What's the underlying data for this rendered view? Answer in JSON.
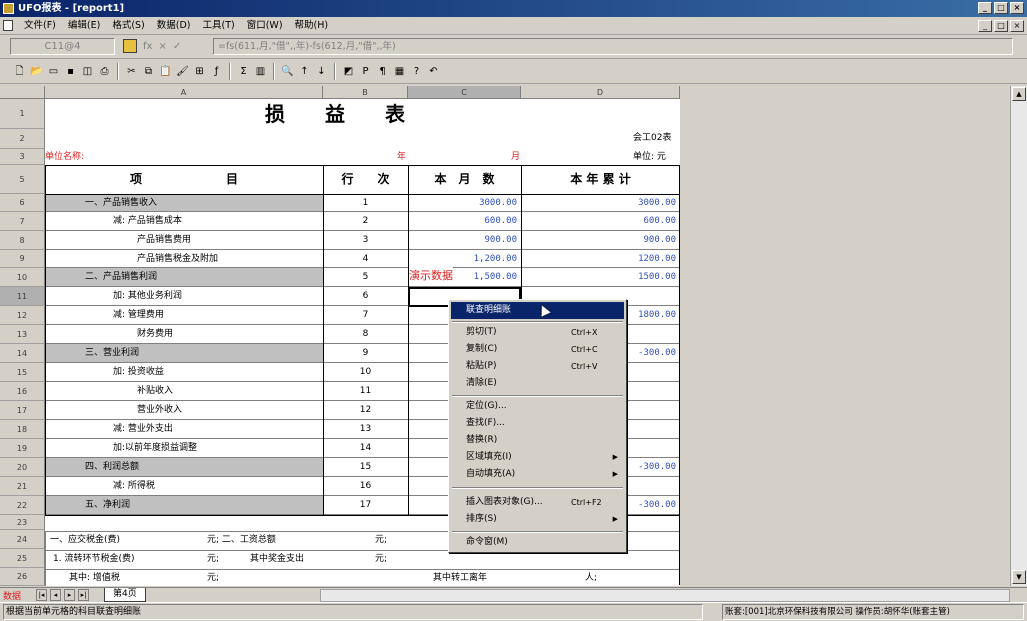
{
  "window": {
    "title": "UFO报表 - [report1]",
    "min": "_",
    "max": "□",
    "close": "×"
  },
  "menubar": {
    "items": [
      "文件(F)",
      "编辑(E)",
      "格式(S)",
      "数据(D)",
      "工具(T)",
      "窗口(W)",
      "帮助(H)"
    ]
  },
  "formulabar": {
    "cellref": "C11@4",
    "fx": "fx",
    "cancel": "×",
    "accept": "✓",
    "formula": "=fs(611,月,\"借\",,年)-fs(612,月,\"借\",,年)"
  },
  "toolbar": {
    "icons": [
      "new-icon",
      "open-icon",
      "close-file-icon",
      "save-icon",
      "print-preview-icon",
      "print-icon",
      "cut-icon",
      "copy-icon",
      "paste-icon",
      "format-painter-icon",
      "insert-icon",
      "function-icon",
      "sum-icon",
      "chart-icon",
      "find-icon",
      "sort-asc-icon",
      "sort-desc-icon",
      "style-icon",
      "bold-icon",
      "mode-icon",
      "page-icon",
      "help-icon",
      "undo-icon"
    ]
  },
  "columns": [
    "A",
    "B",
    "C",
    "D"
  ],
  "rows": [
    "1",
    "2",
    "3",
    "5",
    "6",
    "7",
    "8",
    "9",
    "10",
    "11",
    "12",
    "13",
    "14",
    "15",
    "16",
    "17",
    "18",
    "19",
    "20",
    "21",
    "22",
    "23",
    "24",
    "25",
    "26"
  ],
  "report": {
    "title": "损　　益　　表",
    "form_no": "会工02表",
    "unit_name_label": "单位名称:",
    "year_label": "年",
    "month_label": "月",
    "currency_label": "单位: 元",
    "headers": {
      "item": "项　　　　　　　目",
      "line": "行　　次",
      "month": "本　月　数",
      "year": "本 年 累 计"
    },
    "lines": [
      {
        "item": "一、产品销售收入",
        "line": "1",
        "month": "3000.00",
        "year": "3000.00",
        "grey": true,
        "indent": 1
      },
      {
        "item": "减: 产品销售成本",
        "line": "2",
        "month": "600.00",
        "year": "600.00",
        "grey": false,
        "indent": 2
      },
      {
        "item": "产品销售费用",
        "line": "3",
        "month": "900.00",
        "year": "900.00",
        "grey": false,
        "indent": 3
      },
      {
        "item": "产品销售税金及附加",
        "line": "4",
        "month": "1,200.00",
        "year": "1200.00",
        "grey": false,
        "indent": 3
      },
      {
        "item": "二、产品销售利润",
        "line": "5",
        "month": "1,500.00",
        "year": "1500.00",
        "grey": true,
        "indent": 1
      },
      {
        "item": "加: 其他业务利润",
        "line": "6",
        "month": "",
        "year": "",
        "grey": false,
        "indent": 2
      },
      {
        "item": "减: 管理费用",
        "line": "7",
        "month": "",
        "year": "1800.00",
        "grey": false,
        "indent": 2
      },
      {
        "item": "财务费用",
        "line": "8",
        "month": "",
        "year": "",
        "grey": false,
        "indent": 3
      },
      {
        "item": "三、营业利润",
        "line": "9",
        "month": "",
        "year": "-300.00",
        "grey": true,
        "indent": 1
      },
      {
        "item": "加: 投资收益",
        "line": "10",
        "month": "",
        "year": "",
        "grey": false,
        "indent": 2
      },
      {
        "item": "补贴收入",
        "line": "11",
        "month": "",
        "year": "",
        "grey": false,
        "indent": 3
      },
      {
        "item": "营业外收入",
        "line": "12",
        "month": "",
        "year": "",
        "grey": false,
        "indent": 3
      },
      {
        "item": "减: 营业外支出",
        "line": "13",
        "month": "",
        "year": "",
        "grey": false,
        "indent": 2
      },
      {
        "item": "加:以前年度损益调整",
        "line": "14",
        "month": "",
        "year": "",
        "grey": false,
        "indent": 2
      },
      {
        "item": "四、利润总额",
        "line": "15",
        "month": "",
        "year": "-300.00",
        "grey": true,
        "indent": 1
      },
      {
        "item": "减: 所得税",
        "line": "16",
        "month": "",
        "year": "",
        "grey": false,
        "indent": 2
      },
      {
        "item": "五、净利润",
        "line": "17",
        "month": "",
        "year": "-300.00",
        "grey": true,
        "indent": 1
      }
    ],
    "notes": {
      "r24a": "一、应交税金(费)",
      "r24b": "元; 二、工资总额",
      "r24c": "元;",
      "r25a": "1. 流转环节税金(费)",
      "r25b": "元;",
      "r25c": "其中奖金支出",
      "r25d": "元;",
      "r26a": "其中: 增值税",
      "r26b": "元;",
      "r26c": "其中转工离年",
      "r26d": "人;"
    }
  },
  "tooltip": "演示数据",
  "context_menu": {
    "items": [
      {
        "label": "联查明细账",
        "shortcut": "",
        "submenu": false
      },
      {
        "label": "剪切(T)",
        "shortcut": "Ctrl+X",
        "submenu": false
      },
      {
        "label": "复制(C)",
        "shortcut": "Ctrl+C",
        "submenu": false
      },
      {
        "label": "粘贴(P)",
        "shortcut": "Ctrl+V",
        "submenu": false
      },
      {
        "label": "清除(E)",
        "shortcut": "",
        "submenu": false
      },
      {
        "label": "定位(G)...",
        "shortcut": "",
        "submenu": false
      },
      {
        "label": "查找(F)...",
        "shortcut": "",
        "submenu": false
      },
      {
        "label": "替换(R)",
        "shortcut": "",
        "submenu": false
      },
      {
        "label": "区域填充(I)",
        "shortcut": "",
        "submenu": true
      },
      {
        "label": "自动填充(A)",
        "shortcut": "",
        "submenu": true
      },
      {
        "label": "插入图表对象(G)...",
        "shortcut": "Ctrl+F2",
        "submenu": false
      },
      {
        "label": "排序(S)",
        "shortcut": "",
        "submenu": true
      },
      {
        "label": "命令窗(M)",
        "shortcut": "",
        "submenu": false
      }
    ]
  },
  "sheettabs": {
    "mode": "数据",
    "nav": [
      "|◂",
      "◂",
      "▸",
      "▸|"
    ],
    "tab": "第4页"
  },
  "statusbar": {
    "left": "根据当前单元格的科目联查明细账",
    "right": "账套:[001]北京环保科技有限公司 操作员:胡怀华(账套主管)"
  }
}
